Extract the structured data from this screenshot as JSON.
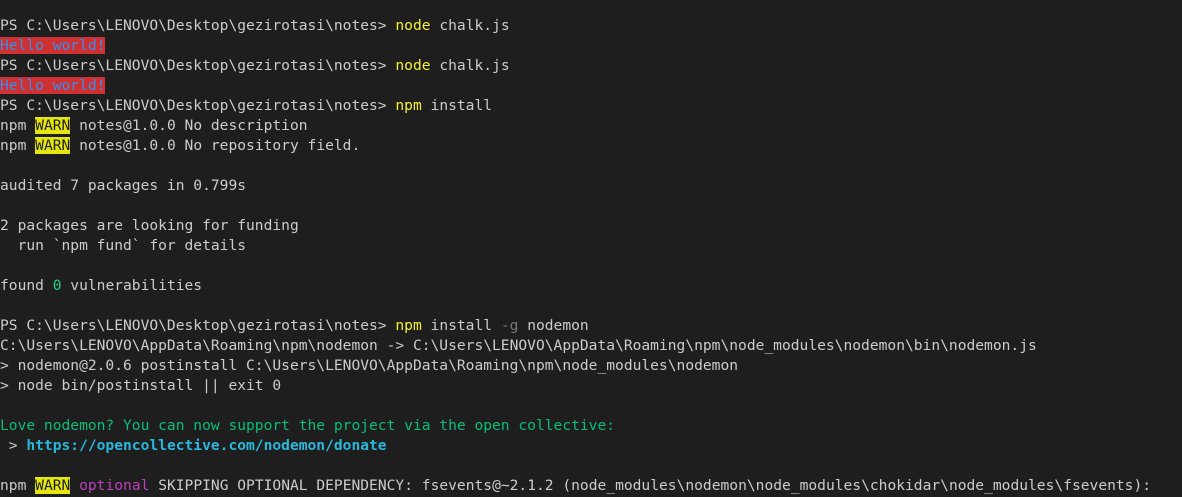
{
  "terminal": {
    "lines": [
      [
        {
          "t": "PS C:\\Users\\LENOVO\\Desktop\\gezirotasi\\notes> ",
          "c": ""
        },
        {
          "t": "node",
          "c": "cmd"
        },
        {
          "t": " chalk.js",
          "c": ""
        }
      ],
      [
        {
          "t": "Hello world!",
          "c": "hello"
        }
      ],
      [
        {
          "t": "PS C:\\Users\\LENOVO\\Desktop\\gezirotasi\\notes> ",
          "c": ""
        },
        {
          "t": "node",
          "c": "cmd"
        },
        {
          "t": " chalk.js",
          "c": ""
        }
      ],
      [
        {
          "t": "Hello world!",
          "c": "hello"
        }
      ],
      [
        {
          "t": "PS C:\\Users\\LENOVO\\Desktop\\gezirotasi\\notes> ",
          "c": ""
        },
        {
          "t": "npm",
          "c": "cmd"
        },
        {
          "t": " install",
          "c": ""
        }
      ],
      [
        {
          "t": "npm ",
          "c": ""
        },
        {
          "t": "WARN",
          "c": "warn"
        },
        {
          "t": " notes@1.0.0 No description",
          "c": ""
        }
      ],
      [
        {
          "t": "npm ",
          "c": ""
        },
        {
          "t": "WARN",
          "c": "warn"
        },
        {
          "t": " notes@1.0.0 No repository field.",
          "c": ""
        }
      ],
      [],
      [
        {
          "t": "audited 7 packages in 0.799s",
          "c": ""
        }
      ],
      [],
      [
        {
          "t": "2 packages are looking for funding",
          "c": ""
        }
      ],
      [
        {
          "t": "  run `npm fund` for details",
          "c": ""
        }
      ],
      [],
      [
        {
          "t": "found ",
          "c": ""
        },
        {
          "t": "0",
          "c": "zero"
        },
        {
          "t": " vulnerabilities",
          "c": ""
        }
      ],
      [],
      [
        {
          "t": "PS C:\\Users\\LENOVO\\Desktop\\gezirotasi\\notes> ",
          "c": ""
        },
        {
          "t": "npm",
          "c": "cmd"
        },
        {
          "t": " install ",
          "c": ""
        },
        {
          "t": "-g",
          "c": "dim"
        },
        {
          "t": " nodemon",
          "c": ""
        }
      ],
      [
        {
          "t": "C:\\Users\\LENOVO\\AppData\\Roaming\\npm\\nodemon -> C:\\Users\\LENOVO\\AppData\\Roaming\\npm\\node_modules\\nodemon\\bin\\nodemon.js",
          "c": ""
        }
      ],
      [
        {
          "t": "> nodemon@2.0.6 postinstall C:\\Users\\LENOVO\\AppData\\Roaming\\npm\\node_modules\\nodemon",
          "c": ""
        }
      ],
      [
        {
          "t": "> node bin/postinstall || exit 0",
          "c": ""
        }
      ],
      [],
      [
        {
          "t": "Love nodemon? You can now support the project via the open collective:",
          "c": "teal"
        }
      ],
      [
        {
          "t": " > ",
          "c": ""
        },
        {
          "t": "https://opencollective.com/nodemon/donate",
          "c": "link"
        }
      ],
      [],
      [
        {
          "t": "npm ",
          "c": ""
        },
        {
          "t": "WARN",
          "c": "warn"
        },
        {
          "t": " ",
          "c": ""
        },
        {
          "t": "optional",
          "c": "magenta"
        },
        {
          "t": " SKIPPING OPTIONAL DEPENDENCY: fsevents@~2.1.2 (node_modules\\nodemon\\node_modules\\chokidar\\node_modules\\fsevents):",
          "c": ""
        }
      ]
    ]
  }
}
